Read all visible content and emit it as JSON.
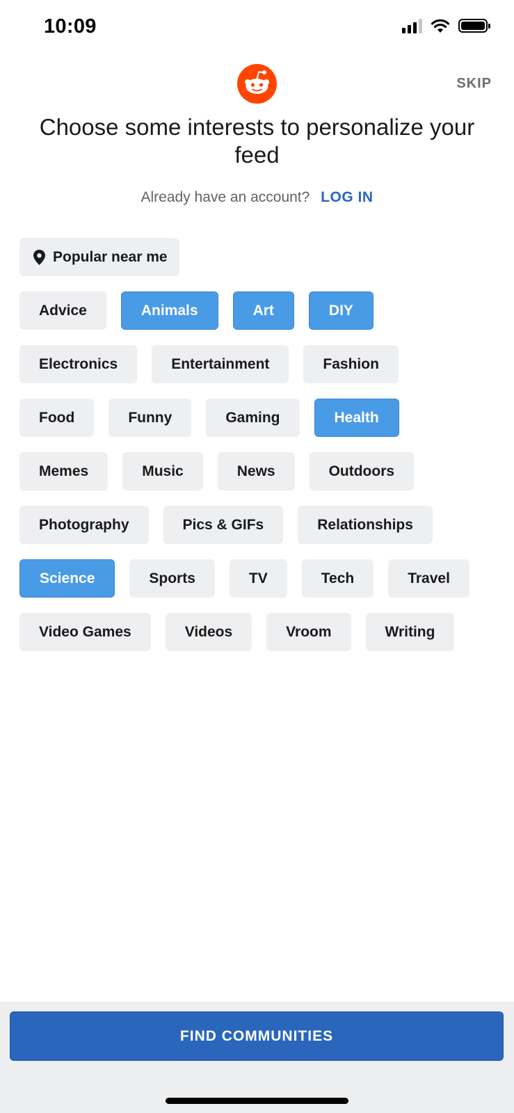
{
  "status_bar": {
    "time": "10:09"
  },
  "header": {
    "skip_label": "SKIP",
    "title": "Choose some interests to personalize your feed",
    "account_prompt": "Already have an account?",
    "login_label": "LOG IN"
  },
  "chips": {
    "location_label": "Popular near me",
    "rows": [
      [
        {
          "label": "Advice",
          "selected": false
        },
        {
          "label": "Animals",
          "selected": true
        },
        {
          "label": "Art",
          "selected": true
        },
        {
          "label": "DIY",
          "selected": true
        }
      ],
      [
        {
          "label": "Electronics",
          "selected": false
        },
        {
          "label": "Entertainment",
          "selected": false
        },
        {
          "label": "Fashion",
          "selected": false
        }
      ],
      [
        {
          "label": "Food",
          "selected": false
        },
        {
          "label": "Funny",
          "selected": false
        },
        {
          "label": "Gaming",
          "selected": false
        },
        {
          "label": "Health",
          "selected": true
        }
      ],
      [
        {
          "label": "Memes",
          "selected": false
        },
        {
          "label": "Music",
          "selected": false
        },
        {
          "label": "News",
          "selected": false
        },
        {
          "label": "Outdoors",
          "selected": false
        }
      ],
      [
        {
          "label": "Photography",
          "selected": false
        },
        {
          "label": "Pics & GIFs",
          "selected": false
        },
        {
          "label": "Relationships",
          "selected": false
        }
      ],
      [
        {
          "label": "Science",
          "selected": true
        },
        {
          "label": "Sports",
          "selected": false
        },
        {
          "label": "TV",
          "selected": false
        },
        {
          "label": "Tech",
          "selected": false
        },
        {
          "label": "Travel",
          "selected": false
        }
      ],
      [
        {
          "label": "Video Games",
          "selected": false
        },
        {
          "label": "Videos",
          "selected": false
        },
        {
          "label": "Vroom",
          "selected": false
        },
        {
          "label": "Writing",
          "selected": false
        }
      ]
    ]
  },
  "footer": {
    "cta_label": "FIND COMMUNITIES"
  },
  "colors": {
    "brand": "#ff4500",
    "chip_selected": "#4a9be6",
    "chip_default": "#eeeff1",
    "cta": "#2a66bb",
    "link": "#2a66c0"
  },
  "icons": [
    "signal-icon",
    "wifi-icon",
    "battery-icon",
    "reddit-logo-icon",
    "location-pin-icon"
  ]
}
